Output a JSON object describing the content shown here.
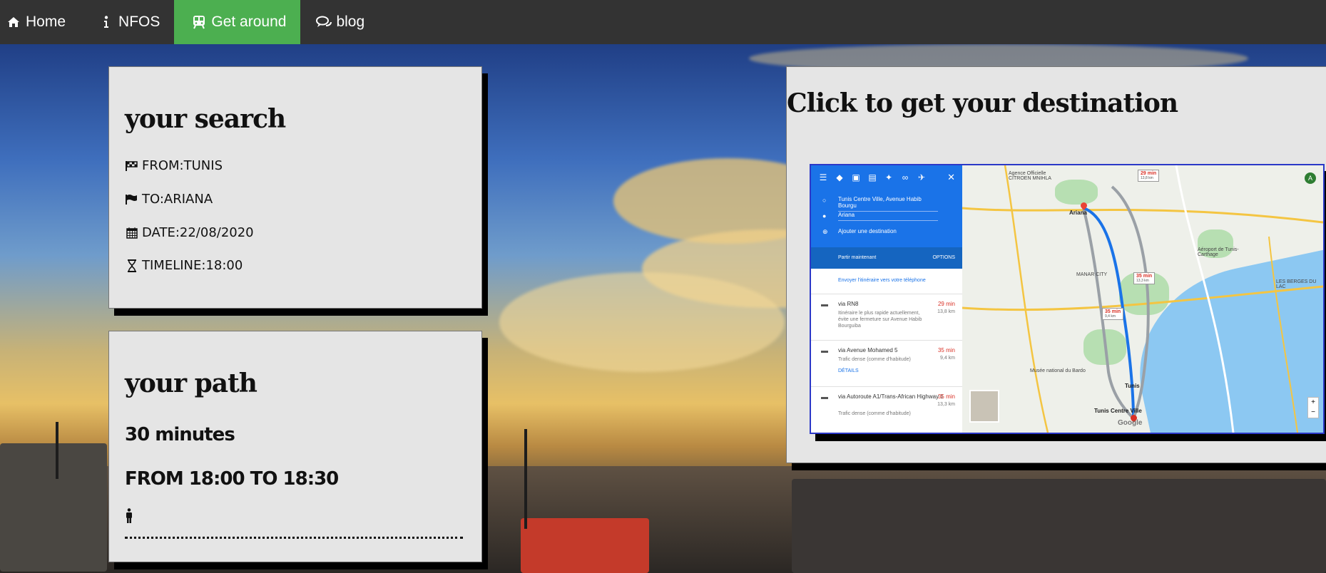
{
  "nav": {
    "items": [
      {
        "label": "Home",
        "icon": "home-icon"
      },
      {
        "label": "NFOS",
        "icon": "info-icon"
      },
      {
        "label": "Get around",
        "icon": "train-icon"
      },
      {
        "label": "blog",
        "icon": "comments-icon"
      }
    ],
    "active": "Get around",
    "active_color": "#4caf50",
    "bar_color": "#333333"
  },
  "search": {
    "title": "your search",
    "from": "FROM:TUNIS",
    "to": "TO:ARIANA",
    "date": "DATE:22/08/2020",
    "timeline": "TIMELINE:18:00"
  },
  "path": {
    "title": "your path",
    "duration": "30 minutes",
    "range": "FROM 18:00 TO 18:30"
  },
  "destination": {
    "title": "Click to get your destination",
    "map": {
      "origin": "Tunis Centre Ville, Avenue Habib Bourgu",
      "destination": "Ariana",
      "add_destination": "Ajouter une destination",
      "depart": "Partir maintenant",
      "options": "OPTIONS",
      "send": "Envoyer l'itinéraire vers votre téléphone",
      "routes": [
        {
          "name": "via RN8",
          "time": "29 min",
          "dist": "13,8 km",
          "desc": "Itinéraire le plus rapide actuellement, évite une fermeture sur Avenue Habib Bourguiba"
        },
        {
          "name": "via Avenue Mohamed 5",
          "time": "35 min",
          "dist": "9,4 km",
          "desc": "Trafic dense (comme d'habitude)",
          "details": "DÉTAILS"
        },
        {
          "name": "via Autoroute A1/Trans-African Highway 1",
          "time": "35 min",
          "dist": "13,3 km",
          "desc": "Trafic dense (comme d'habitude)"
        }
      ],
      "labels": {
        "ariana": "Ariana",
        "tunis": "Tunis",
        "tunis_centre": "Tunis Centre Ville",
        "airport": "Aéroport de Tunis-Carthage",
        "agence": "Agence Officielle CITROEN MNIHLA",
        "lac": "LES BERGES DU LAC",
        "manar": "MANAR CITY",
        "bardo": "Musée national du Bardo",
        "google": "Google",
        "tag1": "29 min",
        "tag1km": "13,8 km",
        "tag2": "35 min",
        "tag2km": "13,3 km",
        "tag3": "35 min",
        "tag3km": "9,4 km",
        "avatar": "A"
      }
    }
  }
}
